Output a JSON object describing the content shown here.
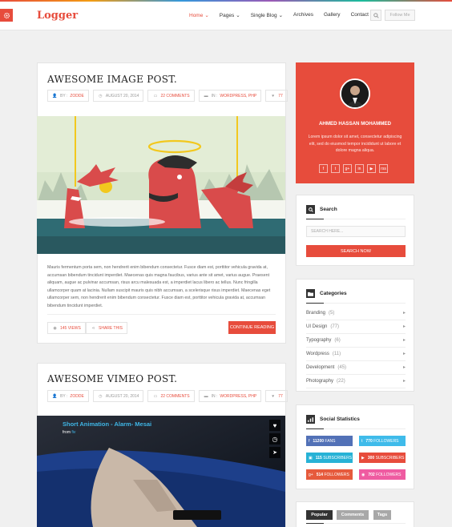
{
  "header": {
    "logo": "Logger",
    "nav": [
      {
        "label": "Home",
        "caret": true,
        "active": true
      },
      {
        "label": "Pages",
        "caret": true,
        "active": false
      },
      {
        "label": "Single Blog",
        "caret": true,
        "active": false
      },
      {
        "label": "Archives",
        "caret": false,
        "active": false
      },
      {
        "label": "Gallery",
        "caret": false,
        "active": false
      },
      {
        "label": "Contact",
        "caret": false,
        "active": false
      }
    ],
    "follow_label": "Follow Me",
    "caret": "⌄"
  },
  "post1": {
    "title": "AWESOME IMAGE POST.",
    "meta": {
      "author_prefix": "BY : ",
      "author": "ZODDE",
      "date": "AUGUST 20, 2014",
      "comments": "22 COMMENTS",
      "category_prefix": "IN : ",
      "category": "WORDPRESS, PHP",
      "likes": "77"
    },
    "excerpt": "Mauris fermentum porta sem, non hendrerit enim bibendum consectetur. Fusce diam est, porttitor vehicula gravida at, accumsan bibendum tincidunt imperdiet. Maecenas quis magna faucibus, varius ante sit amet, varius augue. Praesent aliquam, augue ac pulvinar accumsan, risus arcu malesuada est, a imperdiet lacus libero ac tellus. Nunc fringilla ullamcorper quam at lacinia. Nullam suscipit mauris quis nibh accumsan, a scelerisque risus imperdiet. Maecenas eget ullamcorper sem, non hendrerit enim bibendum consectetur. Fusce diam est, porttitor vehicula gravida at, accumsan bibendum tincidunt imperdiet.",
    "views": "145 VIEWS",
    "share": "SHARE THIS",
    "continue": "CONTINUE READING"
  },
  "post2": {
    "title": "AWESOME VIMEO POST.",
    "meta": {
      "author_prefix": "BY : ",
      "author": "ZODDE",
      "date": "AUGUST 20, 2014",
      "comments": "22 COMMENTS",
      "category_prefix": "IN : ",
      "category": "WORDPRESS, PHP",
      "likes": "77"
    },
    "video_title": "Short Animation - Alarm- Mesai",
    "video_from_prefix": "from ",
    "video_from": "fiv"
  },
  "profile": {
    "name": "AHMED HASSAN MOHAMMED",
    "bio": "Lorem ipsum dolor sit amet, consectetur adipiscing elit, sed do eiusmod tempor incididunt ut labore et dolore magna aliqua.",
    "social": [
      "f",
      "t",
      "g+",
      "in",
      "▶",
      "rss"
    ]
  },
  "search": {
    "title": "Search",
    "placeholder": "SEARCH HERE...",
    "button": "SEARCH NOW"
  },
  "categories": {
    "title": "Categories",
    "items": [
      {
        "label": "Branding",
        "count": "(5)"
      },
      {
        "label": "UI Design",
        "count": "(77)"
      },
      {
        "label": "Typography",
        "count": "(6)"
      },
      {
        "label": "Wordpress",
        "count": "(11)"
      },
      {
        "label": "Development",
        "count": "(45)"
      },
      {
        "label": "Photography",
        "count": "(22)"
      }
    ]
  },
  "social_stats": {
    "title": "Social Statistics",
    "items": [
      {
        "icon": "f",
        "num": "11200",
        "label": "FANS",
        "color": "#5271b7"
      },
      {
        "icon": "t",
        "num": "770",
        "label": "FOLLOWERS",
        "color": "#3fbbea"
      },
      {
        "icon": "▣",
        "num": "115",
        "label": "SUBSCRIBERS",
        "color": "#27b2d6"
      },
      {
        "icon": "▶",
        "num": "300",
        "label": "SUBSCRIBERS",
        "color": "#e74c3c"
      },
      {
        "icon": "g+",
        "num": "514",
        "label": "FOLLOWERS",
        "color": "#e65a3c"
      },
      {
        "icon": "◉",
        "num": "702",
        "label": "FOLLOWERS",
        "color": "#ef5ba1"
      }
    ]
  },
  "tabs": [
    {
      "label": "Popular",
      "color": "#333333"
    },
    {
      "label": "Comments",
      "color": "#a8a8a8"
    },
    {
      "label": "Tags",
      "color": "#a8a8a8"
    }
  ],
  "colors": {
    "accent": "#e74c3c",
    "dark": "#333333"
  }
}
